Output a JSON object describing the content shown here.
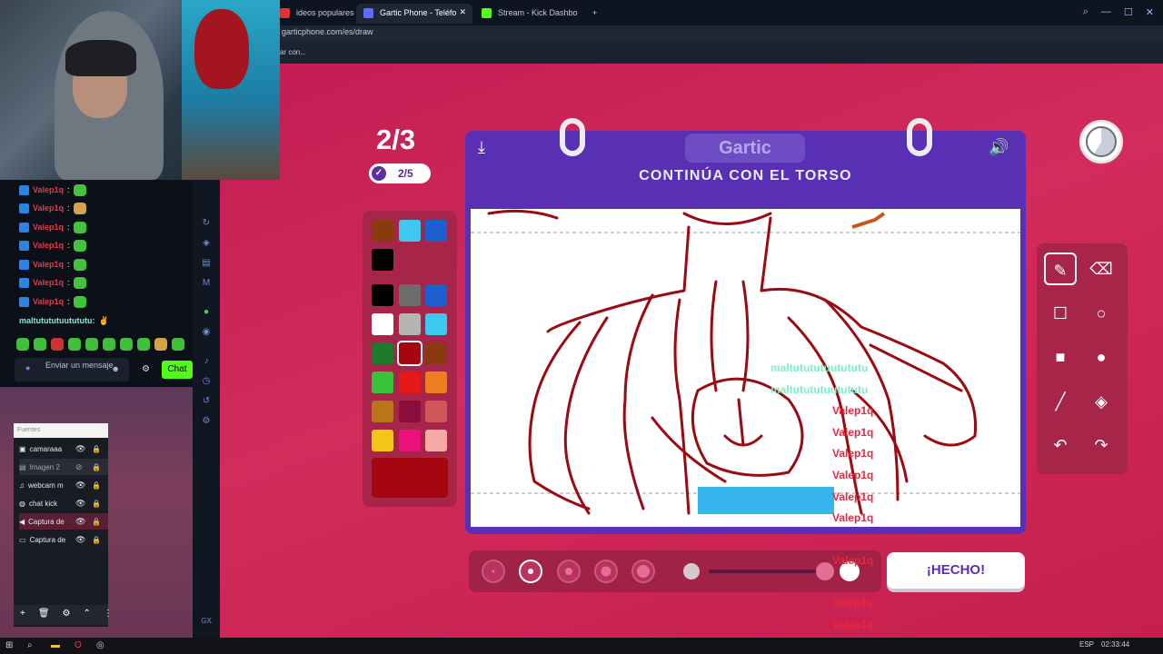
{
  "tabs": [
    {
      "label": "ideos populares sele",
      "active": false
    },
    {
      "label": "Gartic Phone - Teléfo",
      "active": true
    },
    {
      "label": "Stream - Kick Dashbo",
      "active": false
    }
  ],
  "address": "garticphone.com/es/draw",
  "bookmark_hint": "ar con...",
  "chat": {
    "messages": [
      {
        "user": "Valep1q",
        "sep": ":"
      },
      {
        "user": "Valep1q",
        "sep": ":"
      },
      {
        "user": "Valep1q",
        "sep": ":"
      },
      {
        "user": "Valep1q",
        "sep": ":"
      },
      {
        "user": "Valep1q",
        "sep": ":"
      },
      {
        "user": "Valep1q",
        "sep": ":"
      },
      {
        "user": "Valep1q",
        "sep": ":"
      }
    ],
    "last_message_user": "maltutututuutututu:",
    "input_placeholder": "Enviar un mensaje",
    "send_label": "Chat"
  },
  "obs": {
    "header": "Fuentes",
    "sources": [
      "camaraaa",
      "Imagen 2",
      "webcam m",
      "chat kick",
      "Captura de",
      "Captura de"
    ]
  },
  "game": {
    "round": "2/3",
    "substep": "2/5",
    "logo": "Gartic",
    "instruction": "CONTINÚA CON EL TORSO",
    "done_label": "¡HECHO!",
    "palette_colors": [
      "#8a3a10",
      "#3ec8f0",
      "#1d5fd0",
      "#000000",
      "#000000",
      "#6d6d6d",
      "#1d5fd0",
      "#ffffff",
      "#b4b4b4",
      "#3ec8f0",
      "#1d7a2a",
      "#a40710",
      "#8a3a10",
      "#37c23b",
      "#e61717",
      "#f07d1e",
      "#b8751a",
      "#8a0d3c",
      "#cf5757",
      "#f4c416",
      "#e8127a",
      "#f6a9a4"
    ],
    "current_color": "#a40710"
  },
  "overlay_chat": [
    {
      "text": "maltutututuutututu",
      "color": "#7ef0c8"
    },
    {
      "text": "maltutututuutututu",
      "color": "#7ef0c8"
    },
    {
      "text": "Valep1q",
      "color": "#e8263d"
    },
    {
      "text": "Valep1q",
      "color": "#e8263d"
    },
    {
      "text": "Valep1q",
      "color": "#e8263d"
    },
    {
      "text": "Valep1q",
      "color": "#e8263d"
    },
    {
      "text": "Valep1q",
      "color": "#e8263d"
    },
    {
      "text": "Valep1q",
      "color": "#e8263d"
    },
    {
      "text": "Valep1q",
      "color": "#e8263d"
    },
    {
      "text": "Valep1q",
      "color": "#e8263d"
    },
    {
      "text": "Valep1q",
      "color": "#e8263d"
    },
    {
      "text": "maltutututuutututu",
      "color": "#7ef0c8"
    }
  ],
  "taskbar": {
    "lang": "ESP",
    "clock": "02:33:44"
  }
}
